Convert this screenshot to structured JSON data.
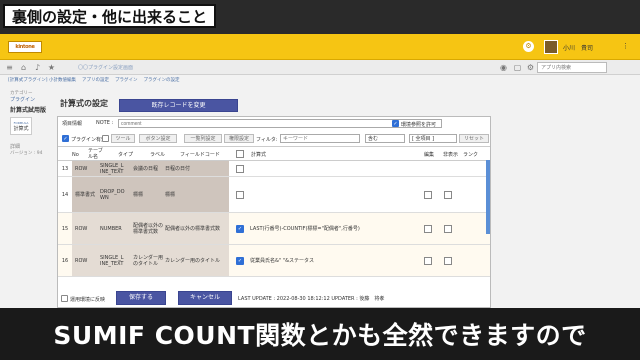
{
  "banner_top": "裏側の設定・他に出来ること",
  "banner_bottom": "SUMIF COUNT関数とかも全然できますので",
  "app": {
    "logo_text": "kintone",
    "user_name": "小川　貴司"
  },
  "navbar": {
    "title": "〇〇プラグイン設定画面",
    "search_placeholder": "アプリ内検索"
  },
  "breadcrumb": [
    "[計算式プラグイン] 小計数値編集",
    "アプリの設定",
    "プラグイン",
    "プラグインの設定"
  ],
  "sidebar": {
    "crumb1": "カテゴリー",
    "crumb2": "プラグイン",
    "bold": "計算式試用版",
    "icon_top": "FORMULA",
    "icon_bottom": "計算式",
    "items": [
      "詳細",
      "バージョン : 94"
    ]
  },
  "main": {
    "title": "計算式の設定",
    "restore_button": "既存レコードを変更"
  },
  "form": {
    "project_info_label": "項目情報",
    "note_label": "NOTE :",
    "note_placeholder": "comment",
    "env_check_label": "環境参照を許可",
    "plugin_enabled_label": "プラグイン有効",
    "toolbar_buttons": [
      "ツール",
      "ボタン設定",
      "一覧列設定",
      "権限設定"
    ],
    "filter_label": "フィルタ:",
    "filter_placeholder": "キーワード",
    "match_select": "含む",
    "all_items_select": "[ 全項目 ]",
    "reset_button": "リセット",
    "plus_button": "+",
    "minus_button": "+"
  },
  "grid": {
    "headers": [
      "No",
      "テーブル名",
      "タイプ",
      "ラベル",
      "フィールドコード",
      "計算式",
      "編集",
      "非表示",
      "ランク"
    ],
    "rows": [
      {
        "no": "13",
        "table": "ROW",
        "type": "SINGLE_L INE_TEXT",
        "label": "会議の日程",
        "code": "日程の日付",
        "formula": ""
      },
      {
        "no": "14",
        "table": "標準書式",
        "type": "DROP_DO WN",
        "label": "標標",
        "code": "標標",
        "formula": ""
      },
      {
        "no": "15",
        "table": "ROW",
        "type": "NUMBER",
        "label": "配偶者以外の標準書式数",
        "code": "配偶者以外の標準書式数",
        "formula": "LAST(行番号)-COUNTIF(標標=\"配偶者\",行番号)"
      },
      {
        "no": "16",
        "table": "ROW",
        "type": "SINGLE_L INE_TEXT",
        "label": "カレンダー用のタイトル",
        "code": "カレンダー用のタイトル",
        "formula": "従業員氏名&\" \"&ステータス"
      }
    ]
  },
  "bottom": {
    "reflect_label": "運用環境に反映",
    "save_button": "保存する",
    "cancel_button": "キャンセル",
    "last_update": "LAST UPDATE : 2022-08-30 18:12:12 UPDATER : 後藤　将孝"
  },
  "colors": {
    "accent": "#f6c513",
    "button": "#4a55a2",
    "checkbox": "#2f6fd6"
  }
}
